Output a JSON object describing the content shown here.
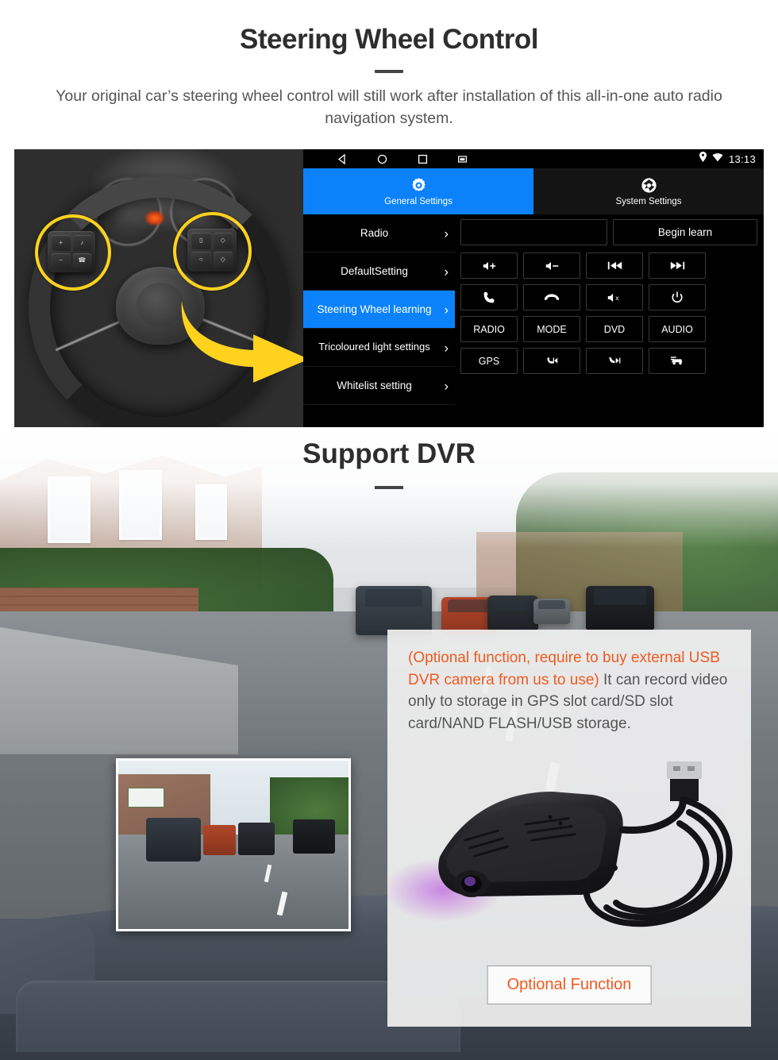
{
  "section1": {
    "title": "Steering Wheel Control",
    "subtitle": "Your original car’s steering wheel control will still work after installation of this all-in-one auto radio navigation system.",
    "photo_alt": "steering-wheel-with-highlighted-control-pads"
  },
  "android": {
    "statusbar": {
      "nav_icons": [
        "back-icon",
        "home-icon",
        "recents-icon",
        "screenshot-icon"
      ],
      "status_icons": [
        "location-pin-icon",
        "wifi-icon"
      ],
      "time": "13:13"
    },
    "tabs": [
      {
        "label": "General Settings",
        "icon": "gear-icon",
        "active": true
      },
      {
        "label": "System Settings",
        "icon": "system-settings-icon",
        "active": false
      }
    ],
    "menu_items": [
      {
        "label": "Radio",
        "selected": false
      },
      {
        "label": "DefaultSetting",
        "selected": false
      },
      {
        "label": "Steering Wheel learning",
        "selected": true
      },
      {
        "label": "Tricoloured light settings",
        "selected": false
      },
      {
        "label": "Whitelist setting",
        "selected": false
      }
    ],
    "menu_chevron": "›",
    "learn_panel": {
      "display_value": "",
      "begin_label": "Begin learn",
      "buttons": [
        {
          "name": "volume-up-button",
          "icon": "speaker-plus-icon",
          "label": ""
        },
        {
          "name": "volume-down-button",
          "icon": "speaker-minus-icon",
          "label": ""
        },
        {
          "name": "previous-track-button",
          "icon": "previous-icon",
          "label": ""
        },
        {
          "name": "next-track-button",
          "icon": "next-icon",
          "label": ""
        },
        {
          "name": "call-answer-button",
          "icon": "phone-icon",
          "label": ""
        },
        {
          "name": "call-hangup-button",
          "icon": "phone-hangup-icon",
          "label": ""
        },
        {
          "name": "mute-button",
          "icon": "speaker-mute-icon",
          "label": ""
        },
        {
          "name": "power-button",
          "icon": "power-icon",
          "label": ""
        },
        {
          "name": "radio-button",
          "icon": "",
          "label": "RADIO"
        },
        {
          "name": "mode-button",
          "icon": "",
          "label": "MODE"
        },
        {
          "name": "dvd-button",
          "icon": "",
          "label": "DVD"
        },
        {
          "name": "audio-button",
          "icon": "",
          "label": "AUDIO"
        },
        {
          "name": "gps-button",
          "icon": "",
          "label": "GPS"
        },
        {
          "name": "call-prev-button",
          "icon": "phone-previous-icon",
          "label": ""
        },
        {
          "name": "call-next-button",
          "icon": "phone-next-icon",
          "label": ""
        },
        {
          "name": "car-info-button",
          "icon": "car-icon",
          "label": ""
        }
      ]
    }
  },
  "section2": {
    "title": "Support DVR",
    "info_highlight": "(Optional function, require to buy external USB DVR camera from us to use)",
    "info_body": "It can record video only to storage in GPS slot card/SD slot card/NAND FLASH/USB storage.",
    "optional_button": "Optional Function",
    "dashcam_preview_alt": "dashcam-street-footage-preview",
    "product_alt": "usb-dvr-camera-with-cable"
  },
  "colors": {
    "accent_blue": "#0b82fa",
    "accent_orange": "#ef5a1f",
    "highlight_yellow": "#ffd21e",
    "text_dark": "#2e2e2e",
    "text_gray": "#555555"
  }
}
